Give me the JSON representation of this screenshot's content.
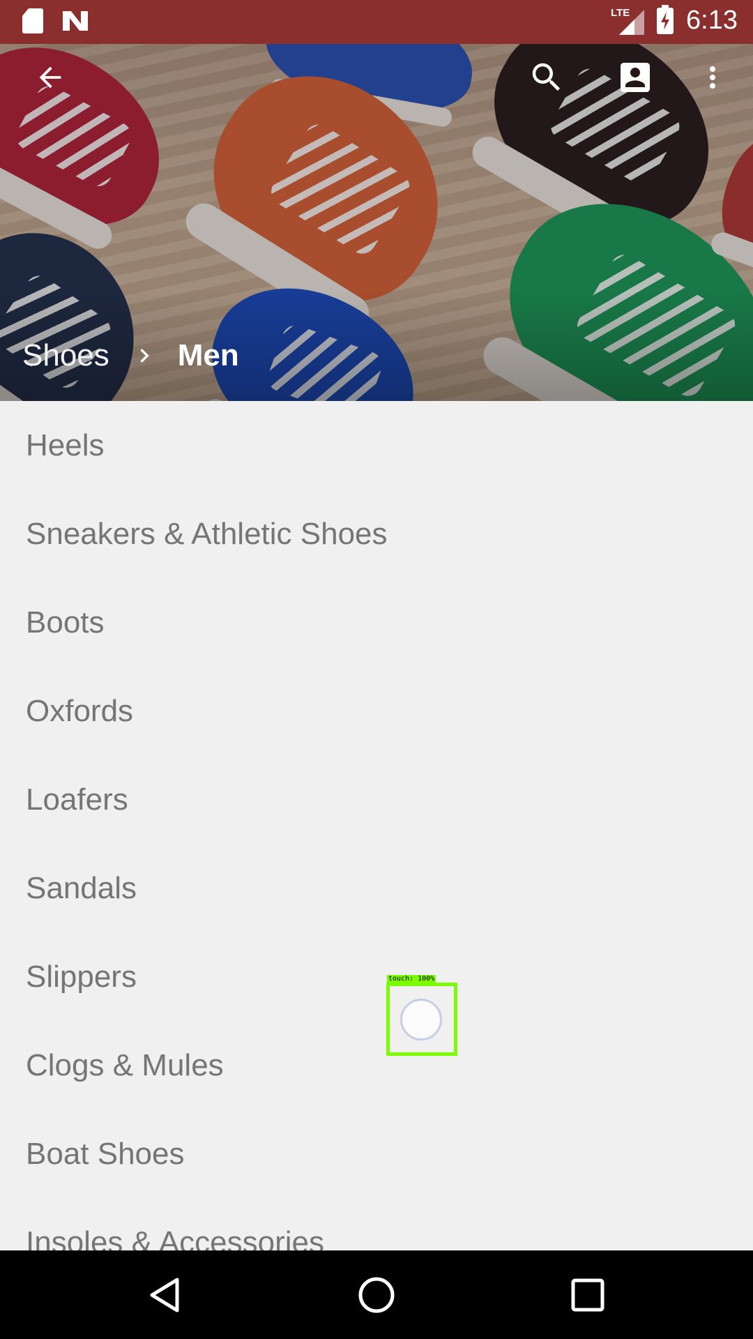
{
  "status_bar": {
    "time": "6:13",
    "network_label": "LTE",
    "icons": [
      "sd-card-icon",
      "n-notification-icon",
      "lte-signal-icon",
      "battery-charging-icon"
    ],
    "background_color": "#8b2e2e"
  },
  "toolbar": {
    "icons": [
      "back-arrow-icon",
      "search-icon",
      "account-icon",
      "more-vert-icon"
    ]
  },
  "breadcrumb": {
    "root": "Shoes",
    "current": "Men"
  },
  "categories": [
    "Heels",
    "Sneakers & Athletic Shoes",
    "Boots",
    "Oxfords",
    "Loafers",
    "Sandals",
    "Slippers",
    "Clogs & Mules",
    "Boat Shoes",
    "Insoles & Accessories"
  ],
  "touch_overlay": {
    "label": "touch: 100%",
    "color": "#7cfc00"
  },
  "nav_bar": {
    "icons": [
      "nav-back-icon",
      "nav-home-icon",
      "nav-recents-icon"
    ]
  }
}
